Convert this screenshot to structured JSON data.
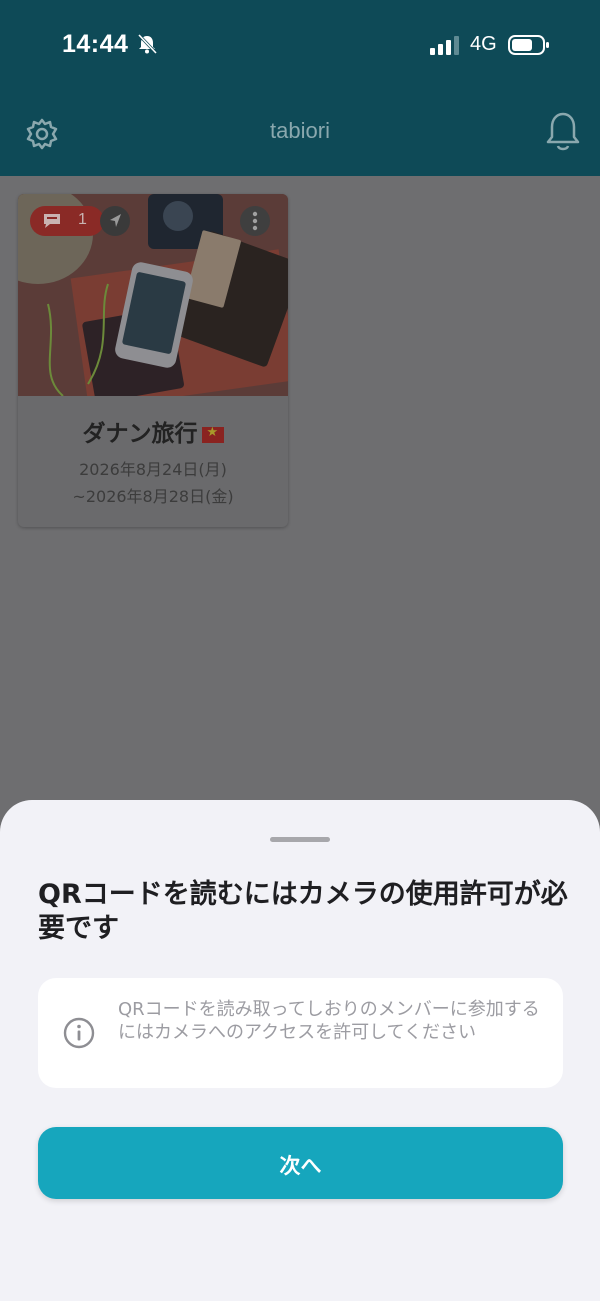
{
  "status_bar": {
    "time": "14:44",
    "network": "4G",
    "icons": [
      "bell-slash-icon",
      "signal-bars-icon",
      "battery-icon"
    ]
  },
  "header": {
    "title": "tabiori",
    "left_icon": "gear-icon",
    "right_icon": "bell-icon"
  },
  "trip_card": {
    "title": "ダナン旅行",
    "flag": "vietnam-flag",
    "date_start": "2026年8月24日(月)",
    "date_end": "~2026年8月28日(金)",
    "chat_badge_count": "1",
    "icons": [
      "chat-icon",
      "navigation-arrow-icon",
      "more-vertical-icon"
    ]
  },
  "sheet": {
    "title": "QRコードを読むにはカメラの使用許可が必要です",
    "info_text": "QRコードを読み取ってしおりのメンバーに参加するにはカメラへのアクセスを許可してください",
    "info_icon": "info-icon",
    "button_label": "次へ"
  },
  "colors": {
    "header_bg": "#0e4a57",
    "overlay_bg": "#6e6e70",
    "sheet_bg": "#f2f2f7",
    "accent": "#16a6bd",
    "badge": "#8a2a26"
  }
}
